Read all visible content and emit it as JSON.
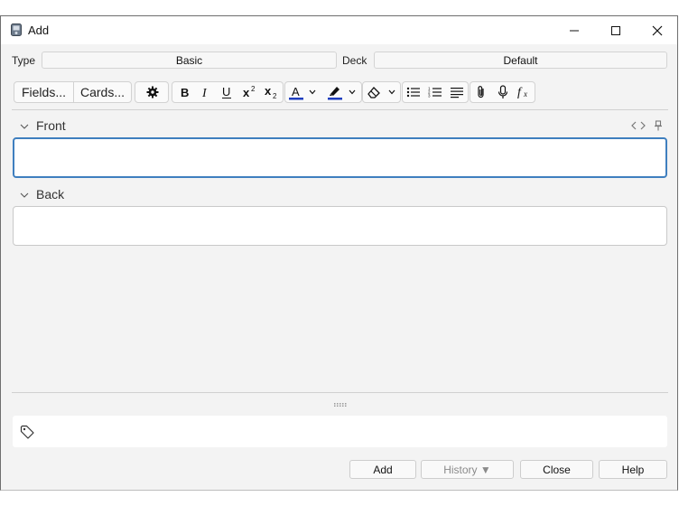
{
  "window": {
    "title": "Add"
  },
  "note_type": {
    "label": "Type",
    "value": "Basic"
  },
  "deck": {
    "label": "Deck",
    "value": "Default"
  },
  "toolbar": {
    "fields_label": "Fields...",
    "cards_label": "Cards..."
  },
  "fields": [
    {
      "name": "Front",
      "value": ""
    },
    {
      "name": "Back",
      "value": ""
    }
  ],
  "buttons": {
    "add": "Add",
    "history": "History ▼",
    "close": "Close",
    "help": "Help"
  },
  "colors": {
    "accent_focus": "#3f7fbf",
    "text_color_bar": "#1f3fbf",
    "highlight_color_bar": "#1f3fbf"
  }
}
